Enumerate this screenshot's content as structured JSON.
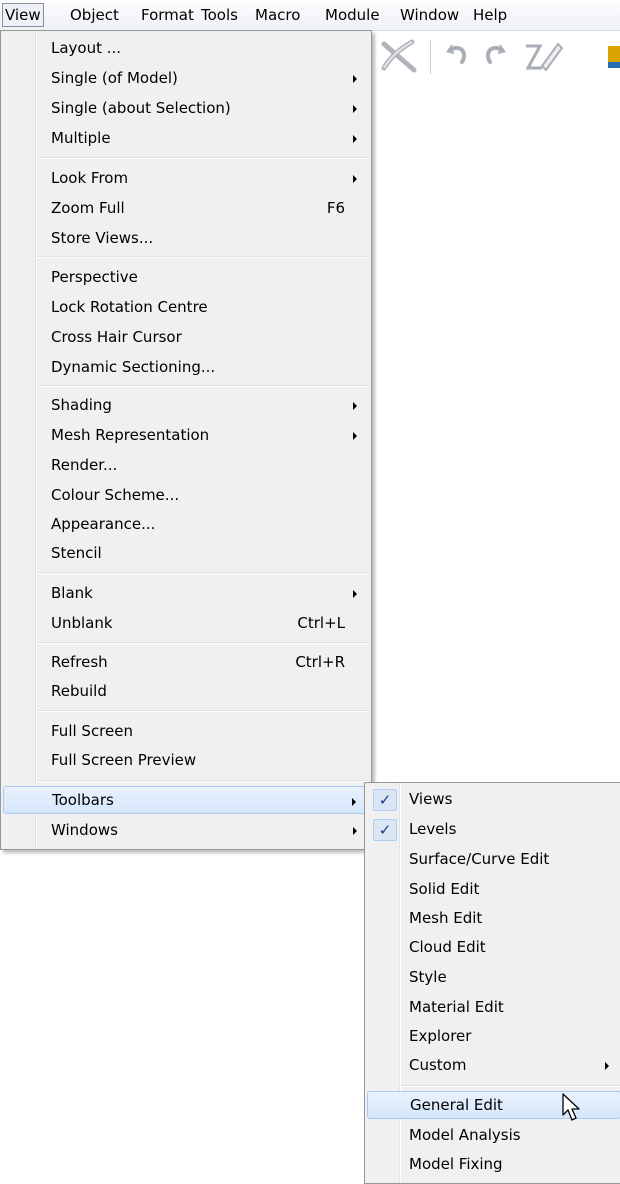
{
  "menubar": {
    "items": [
      {
        "label": "View",
        "active": true
      },
      {
        "label": "Object"
      },
      {
        "label": "Format"
      },
      {
        "label": "Tools"
      },
      {
        "label": "Macro"
      },
      {
        "label": "Module"
      },
      {
        "label": "Window"
      },
      {
        "label": "Help"
      }
    ]
  },
  "toolbar_icons": [
    "delete-icon",
    "undo-icon",
    "redo-icon",
    "edit-pencil-icon",
    "render-icon"
  ],
  "view_menu": {
    "items": [
      {
        "label": "Layout ..."
      },
      {
        "label": "Single (of Model)",
        "submenu": true
      },
      {
        "label": "Single (about Selection)",
        "submenu": true
      },
      {
        "label": "Multiple",
        "submenu": true
      },
      {
        "label": "Look From",
        "submenu": true
      },
      {
        "label": "Zoom Full",
        "shortcut": "F6"
      },
      {
        "label": "Store Views..."
      },
      {
        "label": "Perspective"
      },
      {
        "label": "Lock Rotation Centre"
      },
      {
        "label": "Cross Hair Cursor"
      },
      {
        "label": "Dynamic Sectioning..."
      },
      {
        "label": "Shading",
        "submenu": true
      },
      {
        "label": "Mesh Representation",
        "submenu": true
      },
      {
        "label": "Render..."
      },
      {
        "label": "Colour Scheme..."
      },
      {
        "label": "Appearance..."
      },
      {
        "label": "Stencil"
      },
      {
        "label": "Blank",
        "submenu": true
      },
      {
        "label": "Unblank",
        "shortcut": "Ctrl+L"
      },
      {
        "label": "Refresh",
        "shortcut": "Ctrl+R"
      },
      {
        "label": "Rebuild"
      },
      {
        "label": "Full Screen"
      },
      {
        "label": "Full Screen Preview"
      },
      {
        "label": "Toolbars",
        "submenu": true,
        "highlighted": true
      },
      {
        "label": "Windows",
        "submenu": true
      }
    ]
  },
  "toolbars_submenu": {
    "items": [
      {
        "label": "Views",
        "checked": true
      },
      {
        "label": "Levels",
        "checked": true
      },
      {
        "label": "Surface/Curve Edit"
      },
      {
        "label": "Solid Edit"
      },
      {
        "label": "Mesh Edit"
      },
      {
        "label": "Cloud Edit"
      },
      {
        "label": "Style"
      },
      {
        "label": "Material Edit"
      },
      {
        "label": "Explorer"
      },
      {
        "label": "Custom",
        "submenu": true
      },
      {
        "label": "General Edit",
        "highlighted": true
      },
      {
        "label": "Model Analysis"
      },
      {
        "label": "Model Fixing"
      }
    ]
  },
  "colors": {
    "menu_bg": "#f0f0f0",
    "highlight": "#d5e6fb",
    "check_mark": "#1a3a8a"
  }
}
